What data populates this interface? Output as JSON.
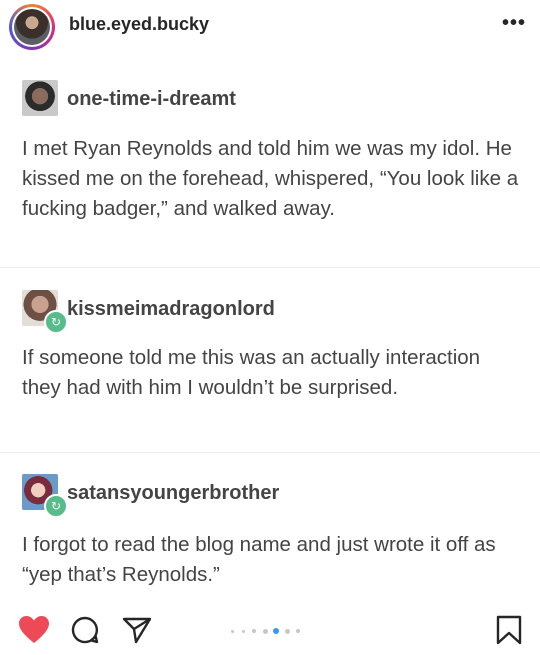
{
  "header": {
    "username": "blue.eyed.bucky",
    "more_glyph": "•••"
  },
  "posts": [
    {
      "blog": "one-time-i-dreamt",
      "text": "I met Ryan Reynolds and told him we was my idol. He kissed me on the forehead, whispered, “You look like a fucking badger,” and walked away.",
      "reblog": false
    },
    {
      "blog": "kissmeimadragonlord",
      "text": "If someone told me this was an actually interaction they had with him I wouldn’t be surprised.",
      "reblog": true
    },
    {
      "blog": "satansyoungerbrother",
      "text": "I forgot to read the blog name and just wrote it off as “yep that’s Reynolds.”",
      "reblog": true
    }
  ],
  "actions": {
    "liked": true,
    "heart_color": "#ed4956",
    "active_dot_color": "#3897f0",
    "carousel_pages": 7,
    "carousel_active_index": 4
  },
  "icons": [
    "heart-icon",
    "comment-icon",
    "share-icon",
    "bookmark-icon",
    "reblog-icon",
    "more-icon"
  ]
}
